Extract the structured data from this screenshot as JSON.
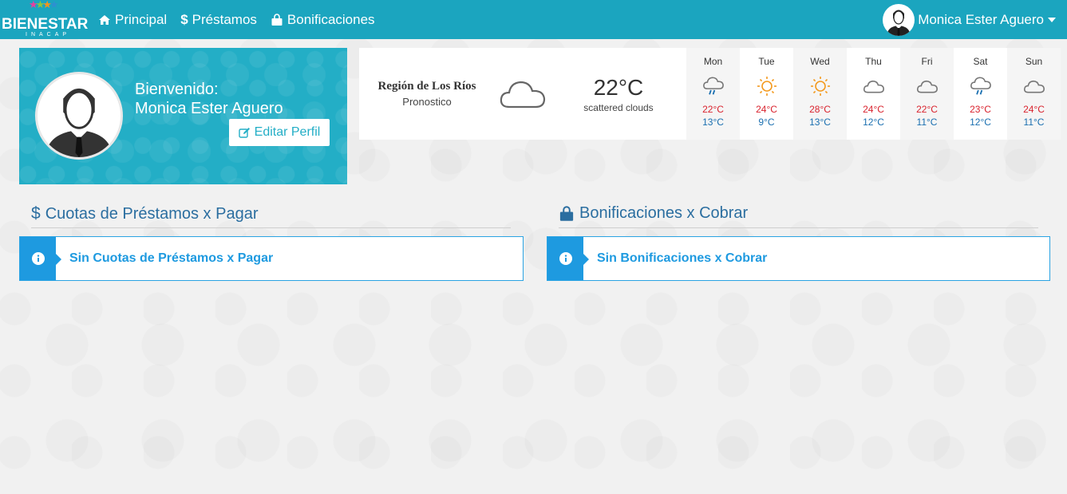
{
  "navbar": {
    "logo_text": "BIENESTAR",
    "logo_subtext": "INACAP",
    "links": [
      {
        "label": "Principal",
        "icon": "home-icon"
      },
      {
        "label": "Préstamos",
        "icon": "dollar-icon"
      },
      {
        "label": "Bonificaciones",
        "icon": "shopping-bag-icon"
      }
    ],
    "user_name": "Monica Ester Aguero",
    "colors": {
      "bar": "#1ba5bf"
    }
  },
  "profile": {
    "welcome_label": "Bienvenido:",
    "name": "Monica Ester Aguero",
    "edit_button": "Editar Perfil"
  },
  "weather": {
    "region": "Región de Los Ríos",
    "subtitle": "Pronostico",
    "current_temp": "22°C",
    "current_desc": "scattered clouds",
    "current_icon": "cloud-icon",
    "forecast": [
      {
        "day": "Mon",
        "icon": "rain-cloud-icon",
        "high": "22°C",
        "low": "13°C"
      },
      {
        "day": "Tue",
        "icon": "sun-icon",
        "high": "24°C",
        "low": "9°C"
      },
      {
        "day": "Wed",
        "icon": "sun-icon",
        "high": "28°C",
        "low": "13°C"
      },
      {
        "day": "Thu",
        "icon": "cloud-icon",
        "high": "24°C",
        "low": "12°C"
      },
      {
        "day": "Fri",
        "icon": "cloud-icon",
        "high": "22°C",
        "low": "11°C"
      },
      {
        "day": "Sat",
        "icon": "rain-cloud-icon",
        "high": "23°C",
        "low": "12°C"
      },
      {
        "day": "Sun",
        "icon": "cloud-icon",
        "high": "24°C",
        "low": "11°C"
      }
    ]
  },
  "loans": {
    "title": "Cuotas de Préstamos x Pagar",
    "message": "Sin Cuotas de Préstamos x Pagar"
  },
  "bonuses": {
    "title": "Bonificaciones x Cobrar",
    "message": "Sin Bonificaciones x Cobrar"
  }
}
